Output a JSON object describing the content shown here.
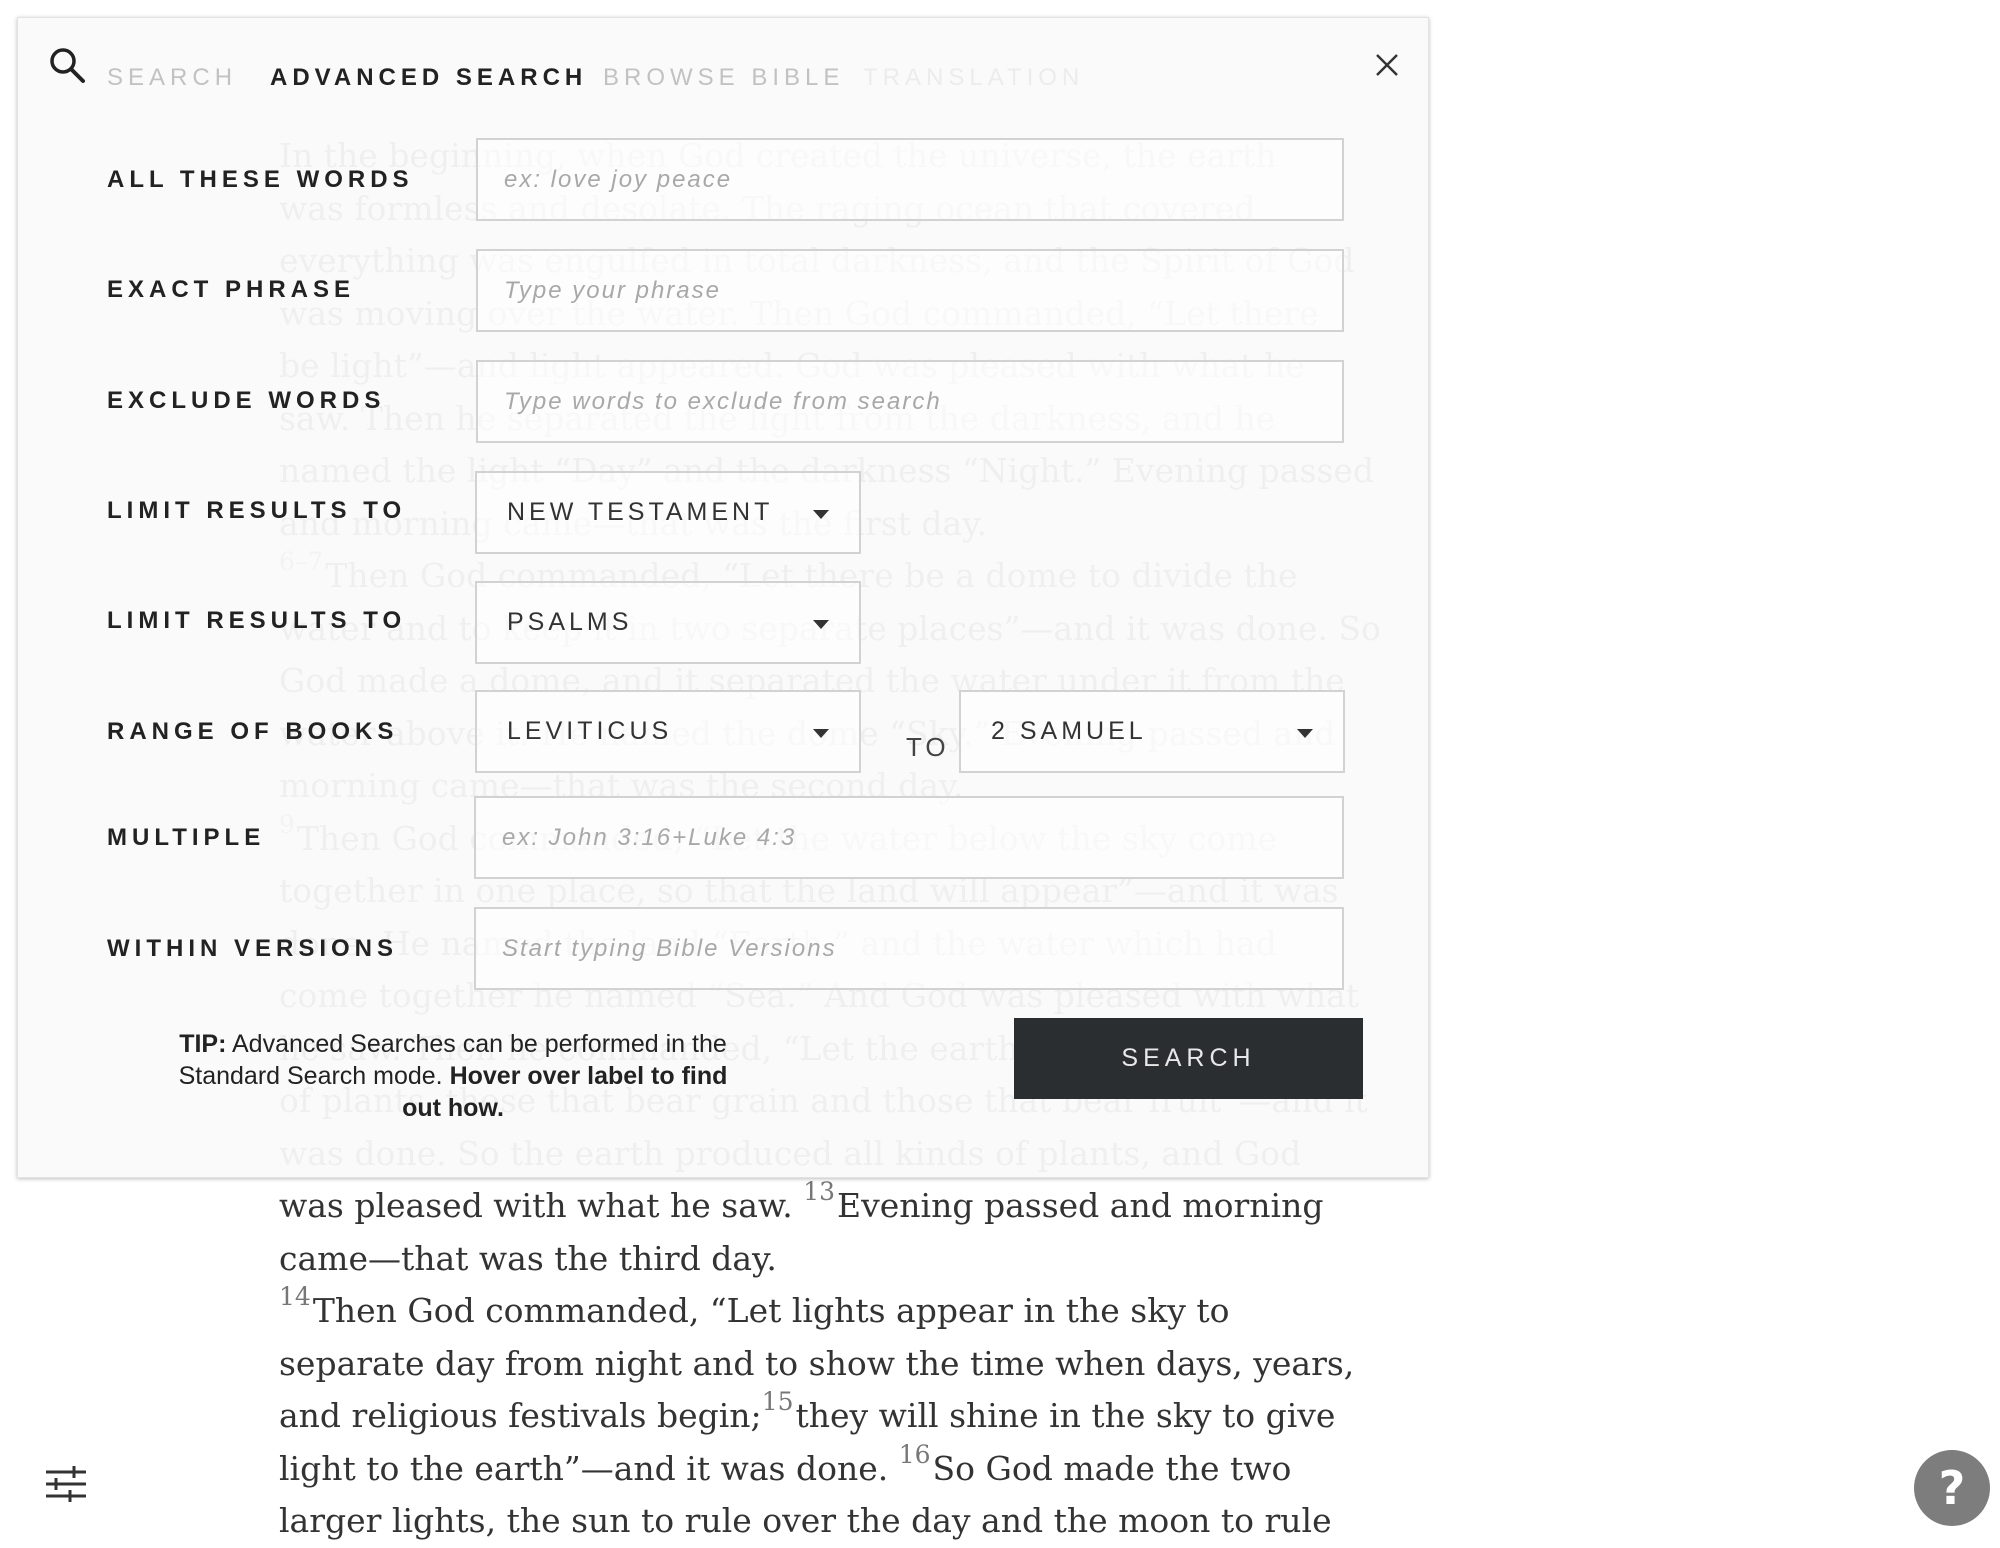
{
  "reader": {
    "lines": [
      {
        "num": "",
        "text": "In the beginning, when God created the universe, the earth"
      },
      {
        "num": "",
        "text": "was formless and desolate. The raging ocean that covered"
      },
      {
        "num": "",
        "text": "everything was engulfed in total darkness, and the Spirit of God"
      },
      {
        "num": "",
        "text": "was moving over the water. Then God commanded, “Let there"
      },
      {
        "num": "",
        "text": "be light”—and light appeared. God was pleased with what he"
      },
      {
        "num": "",
        "text": "saw. Then he separated the light from the darkness, and he"
      },
      {
        "num": "",
        "text": "named the light “Day” and the darkness “Night.” Evening passed"
      },
      {
        "num": "",
        "text": "and morning came—that was the first day."
      },
      {
        "num": "6–7",
        "text": "Then God commanded, “Let there be a dome to divide the"
      },
      {
        "num": "",
        "text": "water and to keep it in two separate places”—and it was done. So"
      },
      {
        "num": "",
        "text": "God made a dome, and it separated the water under it from the"
      },
      {
        "num": "",
        "text": "water above it. He named the dome “Sky.” Evening passed and"
      },
      {
        "num": "",
        "text": "morning came—that was the second day."
      },
      {
        "num": "9",
        "text": "Then God commanded, “Let the water below the sky come"
      },
      {
        "num": "",
        "text": "together in one place, so that the land will appear”—and it was"
      },
      {
        "num": "",
        "text": "done. He named the land “Earth,” and the water which had"
      },
      {
        "num": "",
        "text": "come together he named “Sea.” And God was pleased with what"
      },
      {
        "num": "",
        "text": "he saw. Then he commanded, “Let the earth produce all kinds"
      },
      {
        "num": "",
        "text": "of plants, those that bear grain and those that bear fruit”—and it"
      },
      {
        "num": "",
        "text": "was done. So the earth produced all kinds of plants, and God"
      },
      {
        "num": "13",
        "text": "Evening passed and morning",
        "prefix": "was pleased with what he saw. "
      },
      {
        "num": "",
        "text": "came—that was the third day."
      },
      {
        "num": "14",
        "text": "Then God commanded, “Let lights appear in the sky to"
      },
      {
        "num": "",
        "text": "separate day from night and to show the time when days, years,"
      },
      {
        "num": "15",
        "text": "they will shine in the sky to give",
        "prefix": "and religious festivals  begin;"
      },
      {
        "num": "16",
        "text": "So God made the two",
        "prefix": "light to the earth”—and it was done. "
      },
      {
        "num": "",
        "text": "larger lights, the sun to rule over the day and the moon to rule"
      }
    ]
  },
  "modal": {
    "tabs": {
      "search": "SEARCH",
      "advanced": "ADVANCED SEARCH",
      "browse": "BROWSE BIBLE",
      "translation": "TRANSLATION"
    },
    "fields": {
      "all_words": {
        "label": "ALL THESE WORDS",
        "placeholder": "ex: love joy peace"
      },
      "exact_phrase": {
        "label": "EXACT PHRASE",
        "placeholder": "Type your phrase"
      },
      "exclude": {
        "label": "EXCLUDE WORDS",
        "placeholder": "Type words to exclude from search"
      },
      "limit_testament": {
        "label": "LIMIT RESULTS TO",
        "value": "NEW TESTAMENT"
      },
      "limit_book": {
        "label": "LIMIT RESULTS TO",
        "value": "PSALMS"
      },
      "range": {
        "label": "RANGE OF BOOKS",
        "from": "LEVITICUS",
        "to_label": "TO",
        "to": "2 SAMUEL"
      },
      "multiple": {
        "label": "MULTIPLE",
        "placeholder": "ex: John 3:16+Luke 4:3"
      },
      "versions": {
        "label": "WITHIN VERSIONS",
        "placeholder": "Start typing Bible Versions"
      }
    },
    "tip": {
      "prefix": "TIP:",
      "body": " Advanced Searches can be performed in the Standard Search mode. ",
      "hover": "Hover over label to find out how."
    },
    "search_button": "SEARCH"
  },
  "help_label": "?"
}
